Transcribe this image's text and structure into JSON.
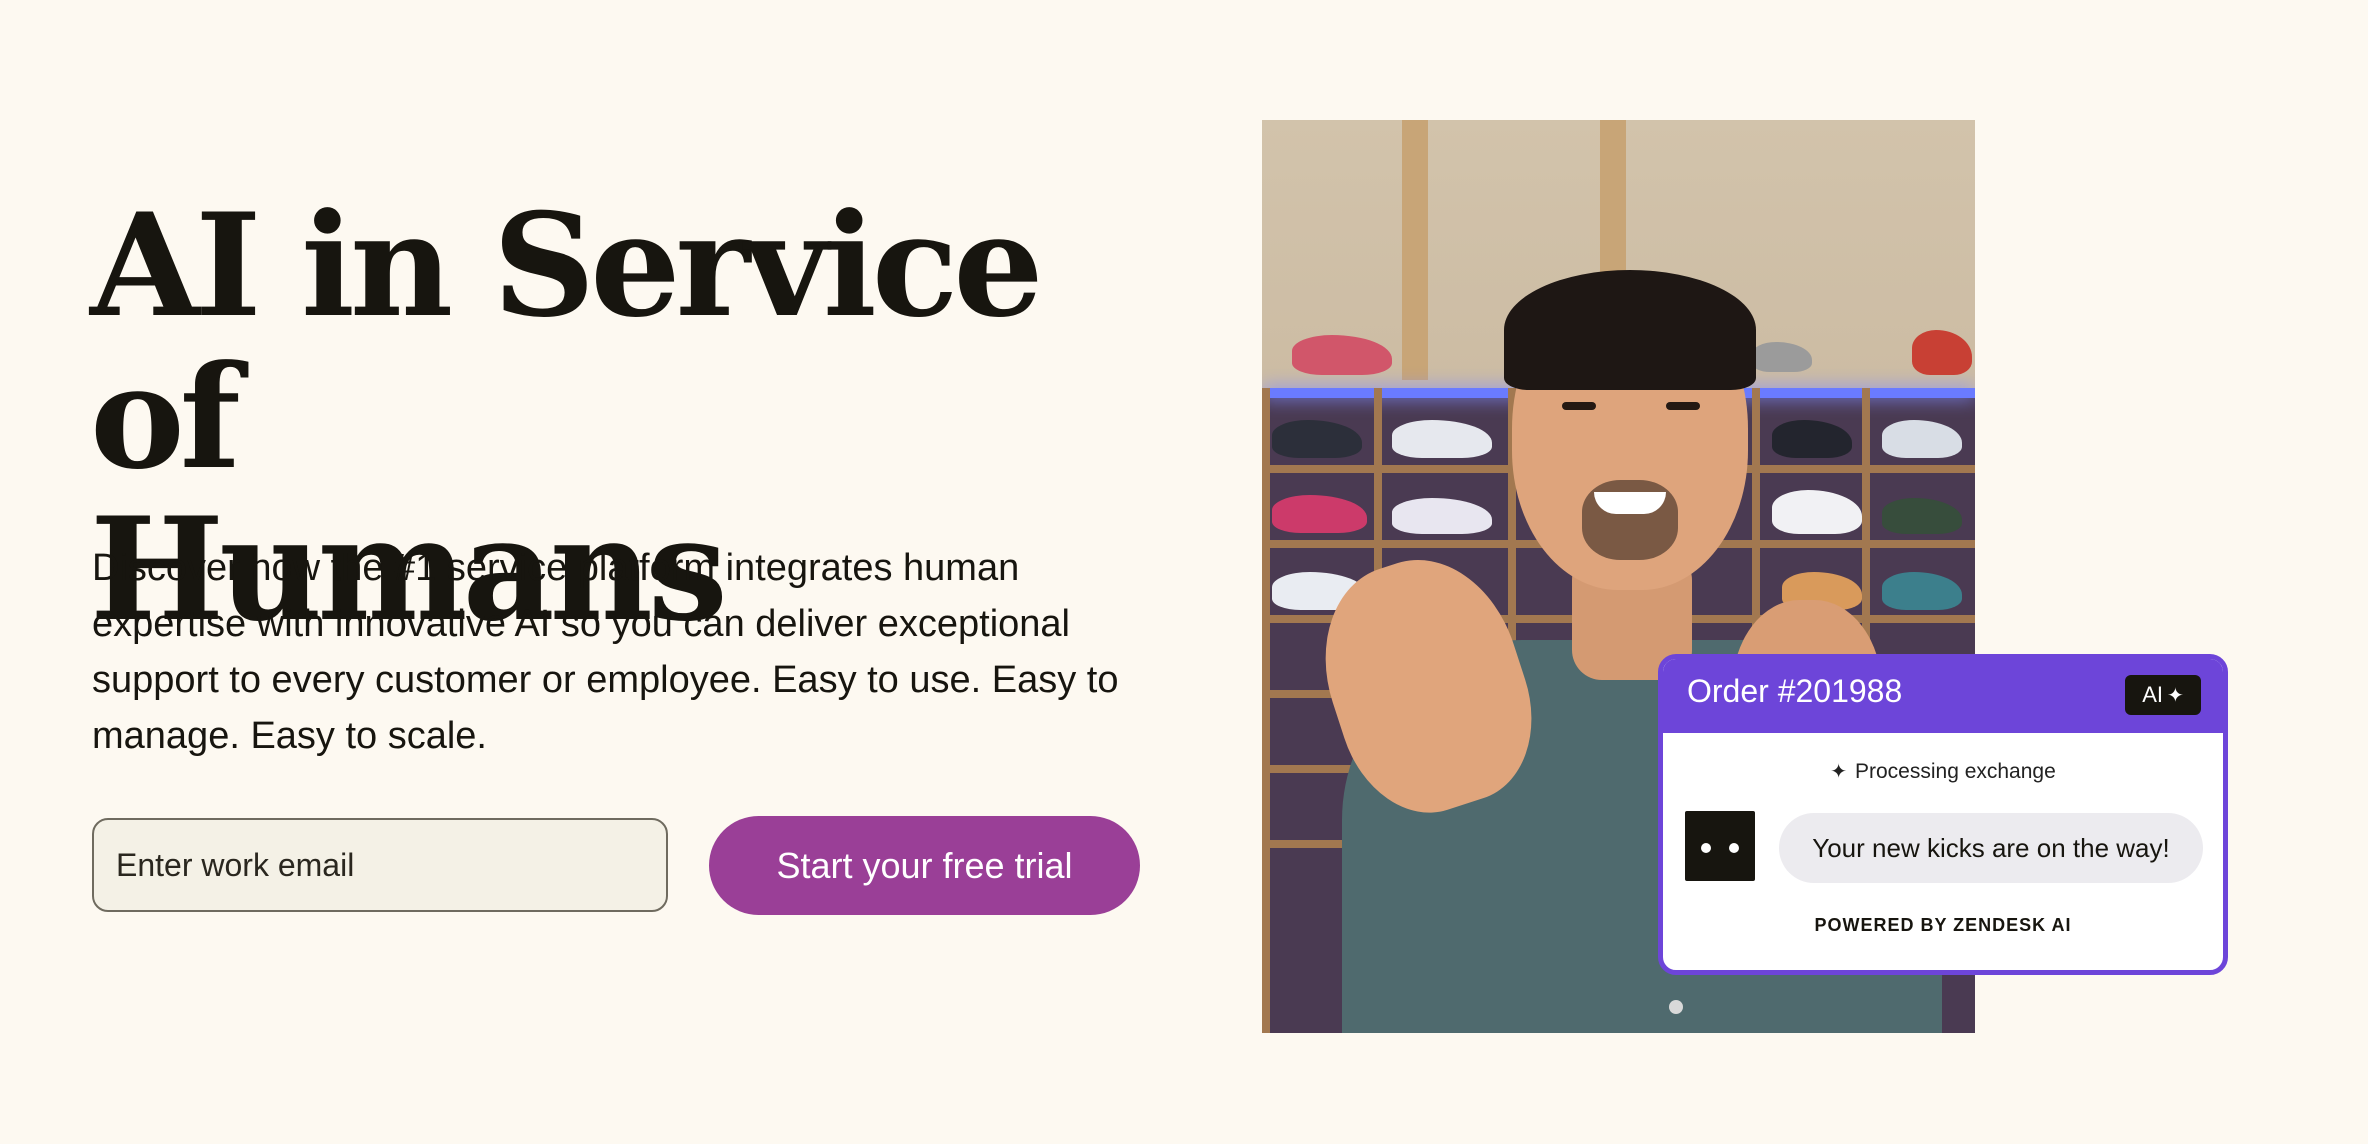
{
  "hero": {
    "title_line1": "AI in Service of",
    "title_line2": "Humans",
    "description": "Discover how the #1 service platform integrates human expertise with innovative AI so you can deliver exceptional support to every customer or employee. Easy to use. Easy to manage. Easy to scale."
  },
  "signup": {
    "email_placeholder": "Enter work email",
    "cta_label": "Start your free trial"
  },
  "order_card": {
    "title": "Order #201988",
    "ai_badge_label": "AI",
    "status_text": "Processing exchange",
    "message": "Your new kicks are on the way!",
    "footer": "POWERED BY ZENDESK AI"
  },
  "colors": {
    "background": "#fdf9f1",
    "cta": "#9a3f97",
    "card_accent": "#6d45d9",
    "text": "#17150f"
  },
  "icons": [
    "sparkle-icon",
    "bot-avatar-icon"
  ]
}
